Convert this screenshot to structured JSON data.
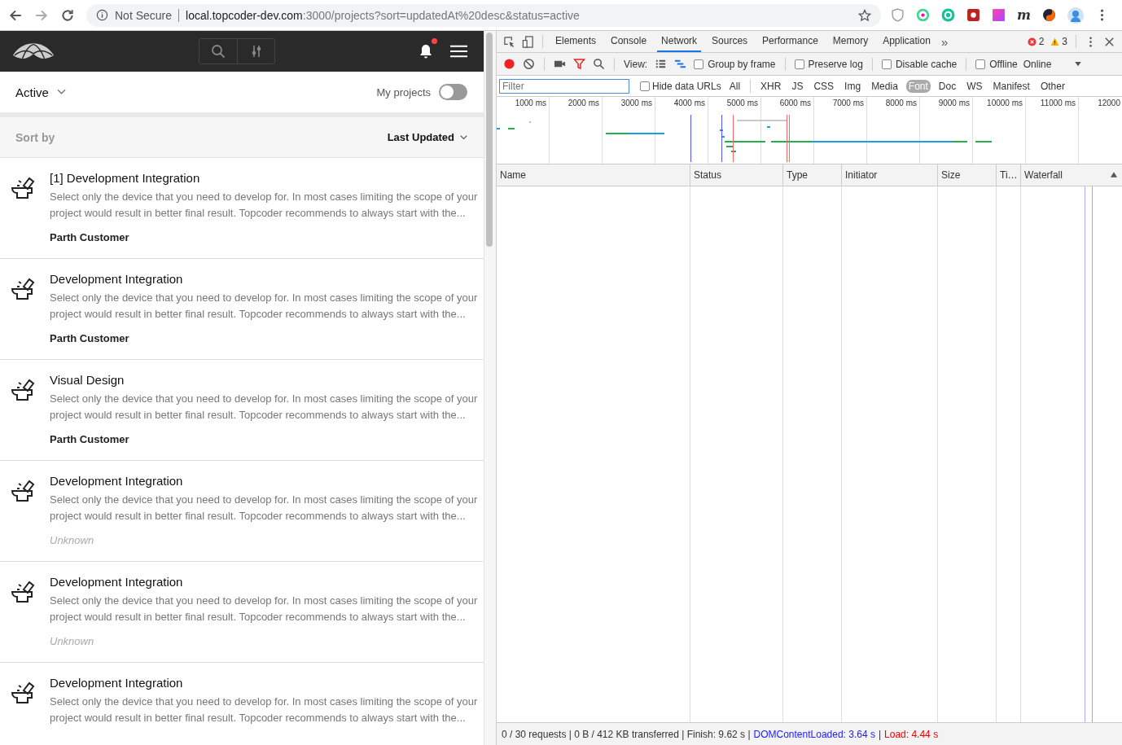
{
  "browser": {
    "security": "Not Secure",
    "url_host": "local.topcoder-dev.com",
    "url_rest": ":3000/projects?sort=updatedAt%20desc&status=active",
    "extension_letter": "m"
  },
  "app": {
    "filter": "Active",
    "my_projects": {
      "label": "My projects",
      "on": false
    },
    "sort_label": "Sort by",
    "sort_value": "Last Updated",
    "notifications_unread": true,
    "projects": [
      {
        "title": "[1] Development Integration",
        "description": "Select only the device that you need to develop for. In most cases limiting the scope of your project would result in better final result. Topcoder recommends to always start with the...",
        "owner": "Parth Customer",
        "owner_known": true
      },
      {
        "title": "Development Integration",
        "description": "Select only the device that you need to develop for. In most cases limiting the scope of your project would result in better final result. Topcoder recommends to always start with the...",
        "owner": "Parth Customer",
        "owner_known": true
      },
      {
        "title": "Visual Design",
        "description": "Select only the device that you need to develop for. In most cases limiting the scope of your project would result in better final result. Topcoder recommends to always start with the...",
        "owner": "Parth Customer",
        "owner_known": true
      },
      {
        "title": "Development Integration",
        "description": "Select only the device that you need to develop for. In most cases limiting the scope of your project would result in better final result. Topcoder recommends to always start with the...",
        "owner": "Unknown",
        "owner_known": false
      },
      {
        "title": "Development Integration",
        "description": "Select only the device that you need to develop for. In most cases limiting the scope of your project would result in better final result. Topcoder recommends to always start with the...",
        "owner": "Unknown",
        "owner_known": false
      },
      {
        "title": "Development Integration",
        "description": "Select only the device that you need to develop for. In most cases limiting the scope of your project would result in better final result. Topcoder recommends to always start with the..."
      }
    ]
  },
  "devtools": {
    "tabs": [
      {
        "label": "Elements",
        "selected": false
      },
      {
        "label": "Console",
        "selected": false
      },
      {
        "label": "Network",
        "selected": true
      },
      {
        "label": "Sources",
        "selected": false
      },
      {
        "label": "Performance",
        "selected": false
      },
      {
        "label": "Memory",
        "selected": false
      },
      {
        "label": "Application",
        "selected": false
      }
    ],
    "more_tabs": "»",
    "errors": "2",
    "warnings": "3",
    "view_label": "View:",
    "recording": true,
    "checkboxes": [
      {
        "label": "Group by frame",
        "checked": false
      },
      {
        "label": "Preserve log",
        "checked": false
      },
      {
        "label": "Disable cache",
        "checked": false
      },
      {
        "label": "Offline",
        "checked": false
      }
    ],
    "throttling": "Online",
    "filter_placeholder": "Filter",
    "hide_data_urls": {
      "label": "Hide data URLs",
      "checked": false
    },
    "type_filters": [
      {
        "label": "All",
        "selected": false
      },
      {
        "label": "XHR",
        "selected": false
      },
      {
        "label": "JS",
        "selected": false
      },
      {
        "label": "CSS",
        "selected": false
      },
      {
        "label": "Img",
        "selected": false
      },
      {
        "label": "Media",
        "selected": false
      },
      {
        "label": "Font",
        "selected": true
      },
      {
        "label": "Doc",
        "selected": false
      },
      {
        "label": "WS",
        "selected": false
      },
      {
        "label": "Manifest",
        "selected": false
      },
      {
        "label": "Other",
        "selected": false
      }
    ],
    "timeline_ticks": [
      "1000 ms",
      "2000 ms",
      "3000 ms",
      "4000 ms",
      "5000 ms",
      "6000 ms",
      "7000 ms",
      "8000 ms",
      "9000 ms",
      "10000 ms",
      "11000 ms",
      "12000"
    ],
    "columns": [
      {
        "label": "Name",
        "sorted": false
      },
      {
        "label": "Status",
        "sorted": false
      },
      {
        "label": "Type",
        "sorted": false
      },
      {
        "label": "Initiator",
        "sorted": false
      },
      {
        "label": "Size",
        "sorted": false
      },
      {
        "label": "Ti…",
        "sorted": false
      },
      {
        "label": "Waterfall",
        "sorted": true
      }
    ],
    "status": {
      "summary": "0 / 30 requests | 0 B / 412 KB transferred | Finish: 9.62 s |",
      "dom_loaded": "DOMContentLoaded: 3.64 s",
      "separator": "|",
      "load": "Load: 4.44 s"
    }
  }
}
